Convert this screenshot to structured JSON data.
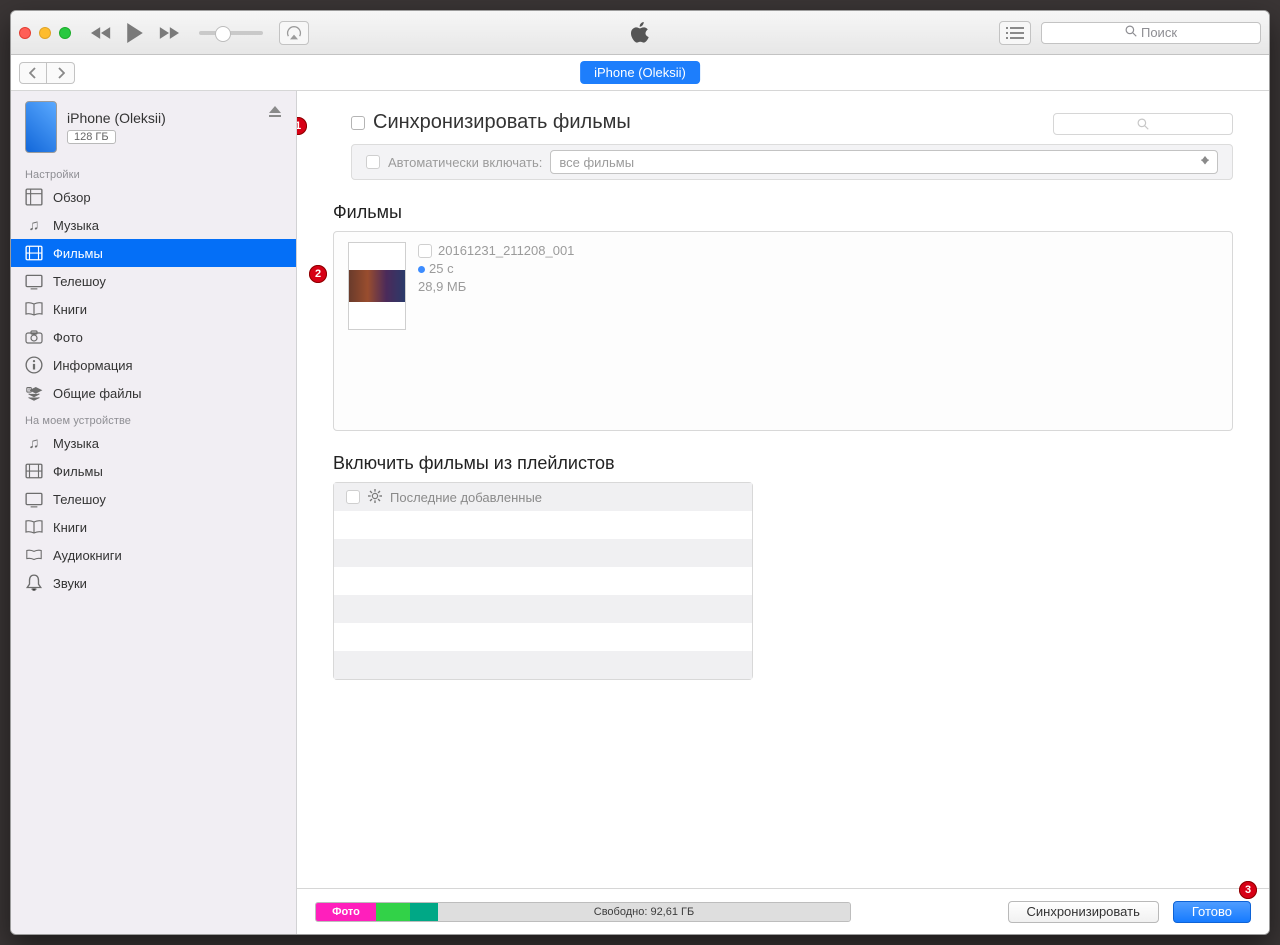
{
  "toolbar": {
    "search_placeholder": "Поиск"
  },
  "nav": {
    "pill_label": "iPhone (Oleksii)"
  },
  "device": {
    "name": "iPhone (Oleksii)",
    "capacity": "128 ГБ"
  },
  "sidebar": {
    "settings_header": "Настройки",
    "settings_items": [
      {
        "key": "summary",
        "label": "Обзор"
      },
      {
        "key": "music",
        "label": "Музыка"
      },
      {
        "key": "movies",
        "label": "Фильмы"
      },
      {
        "key": "tvshows",
        "label": "Телешоу"
      },
      {
        "key": "books",
        "label": "Книги"
      },
      {
        "key": "photos",
        "label": "Фото"
      },
      {
        "key": "info",
        "label": "Информация"
      },
      {
        "key": "shared",
        "label": "Общие файлы"
      }
    ],
    "device_header": "На моем устройстве",
    "device_items": [
      {
        "key": "d_music",
        "label": "Музыка"
      },
      {
        "key": "d_movies",
        "label": "Фильмы"
      },
      {
        "key": "d_tv",
        "label": "Телешоу"
      },
      {
        "key": "d_books",
        "label": "Книги"
      },
      {
        "key": "d_audiobooks",
        "label": "Аудиокниги"
      },
      {
        "key": "d_ringtones",
        "label": "Звуки"
      }
    ],
    "selected_key": "movies"
  },
  "main": {
    "sync_title": "Синхронизировать фильмы",
    "auto_label": "Автоматически включать:",
    "auto_selected": "все фильмы",
    "movies_header": "Фильмы",
    "movies": [
      {
        "name": "20161231_211208_001",
        "duration": "25 с",
        "size": "28,9 МБ"
      }
    ],
    "playlists_header": "Включить фильмы из плейлистов",
    "playlists": [
      {
        "name": "Последние добавленные"
      }
    ]
  },
  "footer": {
    "photo_label": "Фото",
    "free_label": "Свободно: 92,61 ГБ",
    "sync_button": "Синхронизировать",
    "done_button": "Готово"
  },
  "annotations": {
    "a1": "1",
    "a2": "2",
    "a3": "3"
  }
}
